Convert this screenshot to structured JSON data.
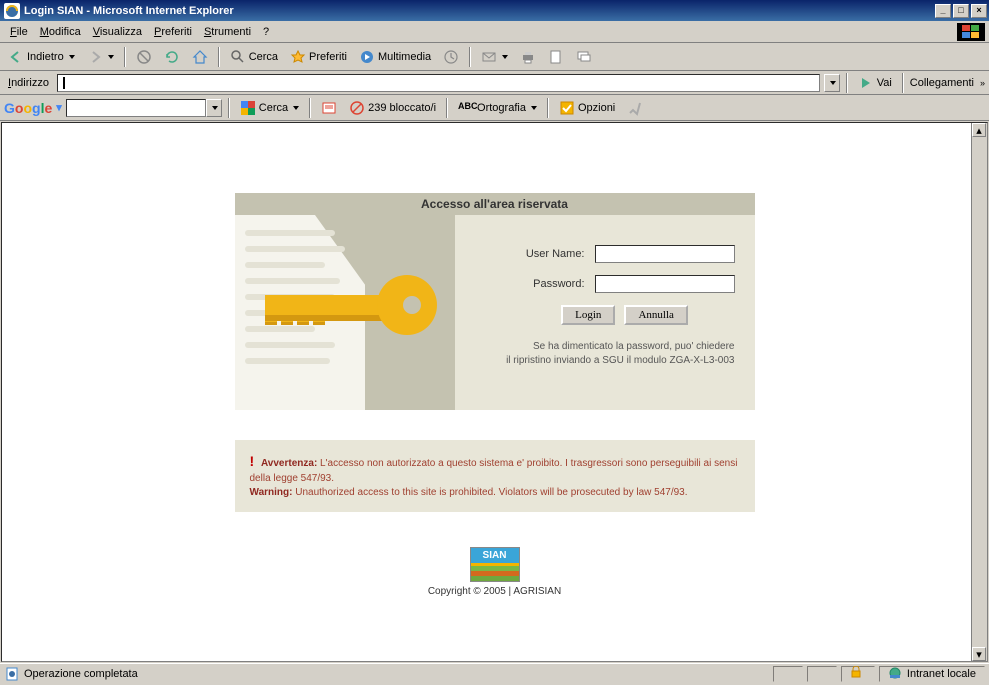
{
  "window": {
    "title": "Login SIAN - Microsoft Internet Explorer"
  },
  "menu": {
    "file": "File",
    "modifica": "Modifica",
    "visualizza": "Visualizza",
    "preferiti": "Preferiti",
    "strumenti": "Strumenti",
    "help": "?"
  },
  "toolbar": {
    "indietro": "Indietro",
    "cerca": "Cerca",
    "preferiti": "Preferiti",
    "multimedia": "Multimedia"
  },
  "addressbar": {
    "label": "Indirizzo",
    "value": "",
    "go": "Vai",
    "collegamenti": "Collegamenti"
  },
  "googlebar": {
    "logo": "Google",
    "cerca": "Cerca",
    "bloccato": "239 bloccato/i",
    "ortografia": "Ortografia",
    "opzioni": "Opzioni"
  },
  "page": {
    "header": "Accesso all'area riservata",
    "username_label": "User Name:",
    "password_label": "Password:",
    "login_btn": "Login",
    "cancel_btn": "Annulla",
    "forgot_line1": "Se ha dimenticato la password, puo' chiedere",
    "forgot_line2": "il ripristino inviando a SGU il modulo ZGA-X-L3-003",
    "warning_title_it": "Avvertenza:",
    "warning_text_it": " L'accesso non autorizzato a questo sistema e' proibito. I trasgressori sono perseguibili ai sensi della legge 547/93.",
    "warning_title_en": "Warning:",
    "warning_text_en": " Unauthorized access to this site is prohibited. Violators will be prosecuted by law 547/93.",
    "sian_logo_text": "SIAN",
    "copyright": "Copyright © 2005 | AGRISIAN"
  },
  "statusbar": {
    "status": "Operazione completata",
    "zone": "Intranet locale"
  }
}
